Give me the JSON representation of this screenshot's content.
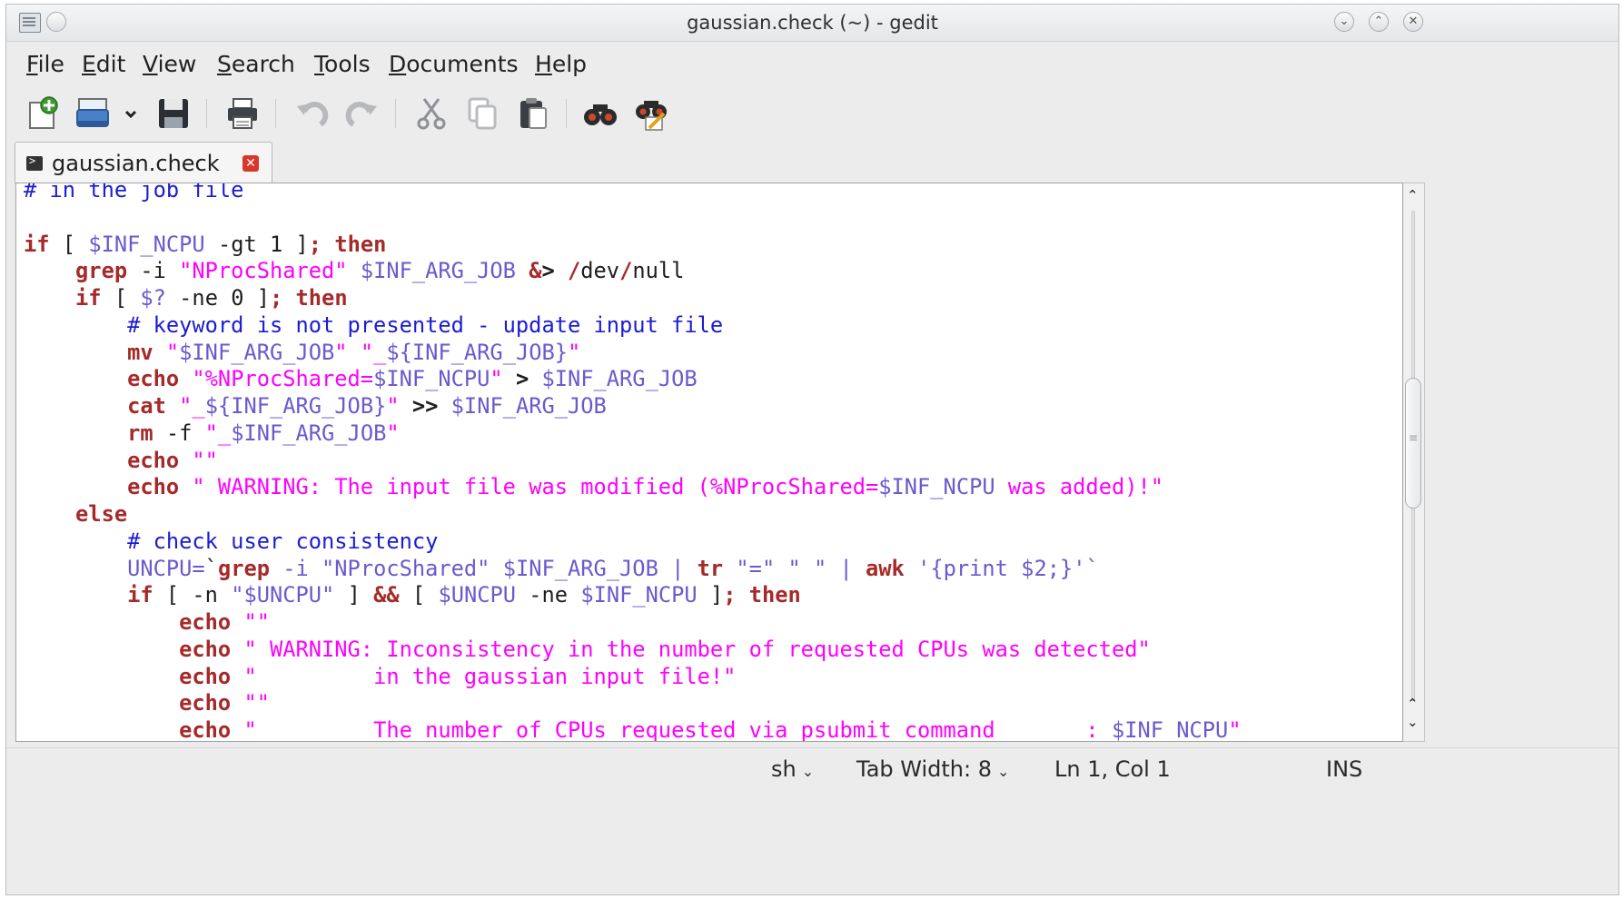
{
  "window": {
    "title": "gaussian.check (~) - gedit"
  },
  "menu": [
    {
      "label": "File",
      "mnemonic": "F",
      "rest": "ile"
    },
    {
      "label": "Edit",
      "mnemonic": "E",
      "rest": "dit"
    },
    {
      "label": "View",
      "mnemonic": "V",
      "rest": "iew"
    },
    {
      "label": "Search",
      "mnemonic": "S",
      "rest": "earch"
    },
    {
      "label": "Tools",
      "mnemonic": "T",
      "rest": "ools"
    },
    {
      "label": "Documents",
      "mnemonic": "D",
      "rest": "ocuments"
    },
    {
      "label": "Help",
      "mnemonic": "H",
      "rest": "elp"
    }
  ],
  "toolbar": {
    "icons": [
      "new-document-icon",
      "open-icon",
      "open-dropdown-icon",
      "save-icon",
      "print-icon",
      "undo-icon",
      "redo-icon",
      "cut-icon",
      "copy-icon",
      "paste-icon",
      "find-icon",
      "find-replace-icon"
    ]
  },
  "tab": {
    "label": "gaussian.check"
  },
  "code": {
    "lines": [
      [
        {
          "t": "# in the job file",
          "c": "cm"
        }
      ],
      [],
      [
        {
          "t": "if",
          "c": "kw"
        },
        {
          "t": " [ ",
          "c": "pl"
        },
        {
          "t": "$INF_NCPU",
          "c": "va"
        },
        {
          "t": " -gt 1 ]",
          "c": "pl"
        },
        {
          "t": ";",
          "c": "kw"
        },
        {
          "t": " ",
          "c": "pl"
        },
        {
          "t": "then",
          "c": "kw"
        }
      ],
      [
        {
          "t": "    ",
          "c": "pl"
        },
        {
          "t": "grep",
          "c": "kw"
        },
        {
          "t": " -i ",
          "c": "pl"
        },
        {
          "t": "\"NProcShared\"",
          "c": "st"
        },
        {
          "t": " ",
          "c": "pl"
        },
        {
          "t": "$INF_ARG_JOB",
          "c": "va"
        },
        {
          "t": " ",
          "c": "pl"
        },
        {
          "t": "&",
          "c": "kw"
        },
        {
          "t": "> ",
          "c": "op"
        },
        {
          "t": "/",
          "c": "kw"
        },
        {
          "t": "dev",
          "c": "pl"
        },
        {
          "t": "/",
          "c": "kw"
        },
        {
          "t": "null",
          "c": "pl"
        }
      ],
      [
        {
          "t": "    ",
          "c": "pl"
        },
        {
          "t": "if",
          "c": "kw"
        },
        {
          "t": " [ ",
          "c": "pl"
        },
        {
          "t": "$?",
          "c": "va"
        },
        {
          "t": " -ne 0 ]",
          "c": "pl"
        },
        {
          "t": ";",
          "c": "kw"
        },
        {
          "t": " ",
          "c": "pl"
        },
        {
          "t": "then",
          "c": "kw"
        }
      ],
      [
        {
          "t": "        ",
          "c": "pl"
        },
        {
          "t": "# keyword is not presented - update input file",
          "c": "cm"
        }
      ],
      [
        {
          "t": "        ",
          "c": "pl"
        },
        {
          "t": "mv",
          "c": "kw"
        },
        {
          "t": " ",
          "c": "pl"
        },
        {
          "t": "\"",
          "c": "st"
        },
        {
          "t": "$INF_ARG_JOB",
          "c": "va"
        },
        {
          "t": "\" \"_",
          "c": "st"
        },
        {
          "t": "${INF_ARG_JOB}",
          "c": "va"
        },
        {
          "t": "\"",
          "c": "st"
        }
      ],
      [
        {
          "t": "        ",
          "c": "pl"
        },
        {
          "t": "echo",
          "c": "kw"
        },
        {
          "t": " ",
          "c": "pl"
        },
        {
          "t": "\"%NProcShared=",
          "c": "st"
        },
        {
          "t": "$INF_NCPU",
          "c": "va"
        },
        {
          "t": "\"",
          "c": "st"
        },
        {
          "t": " ",
          "c": "pl"
        },
        {
          "t": ">",
          "c": "op"
        },
        {
          "t": " ",
          "c": "pl"
        },
        {
          "t": "$INF_ARG_JOB",
          "c": "va"
        }
      ],
      [
        {
          "t": "        ",
          "c": "pl"
        },
        {
          "t": "cat",
          "c": "kw"
        },
        {
          "t": " ",
          "c": "pl"
        },
        {
          "t": "\"_",
          "c": "st"
        },
        {
          "t": "${INF_ARG_JOB}",
          "c": "va"
        },
        {
          "t": "\"",
          "c": "st"
        },
        {
          "t": " ",
          "c": "pl"
        },
        {
          "t": ">>",
          "c": "op"
        },
        {
          "t": " ",
          "c": "pl"
        },
        {
          "t": "$INF_ARG_JOB",
          "c": "va"
        }
      ],
      [
        {
          "t": "        ",
          "c": "pl"
        },
        {
          "t": "rm",
          "c": "kw"
        },
        {
          "t": " -f ",
          "c": "pl"
        },
        {
          "t": "\"_",
          "c": "st"
        },
        {
          "t": "$INF_ARG_JOB",
          "c": "va"
        },
        {
          "t": "\"",
          "c": "st"
        }
      ],
      [
        {
          "t": "        ",
          "c": "pl"
        },
        {
          "t": "echo",
          "c": "kw"
        },
        {
          "t": " ",
          "c": "pl"
        },
        {
          "t": "\"\"",
          "c": "st"
        }
      ],
      [
        {
          "t": "        ",
          "c": "pl"
        },
        {
          "t": "echo",
          "c": "kw"
        },
        {
          "t": " ",
          "c": "pl"
        },
        {
          "t": "\" WARNING: The input file was modified (%NProcShared=",
          "c": "st"
        },
        {
          "t": "$INF_NCPU",
          "c": "va"
        },
        {
          "t": " was added)!\"",
          "c": "st"
        }
      ],
      [
        {
          "t": "    ",
          "c": "pl"
        },
        {
          "t": "else",
          "c": "kw"
        }
      ],
      [
        {
          "t": "        ",
          "c": "pl"
        },
        {
          "t": "# check user consistency",
          "c": "cm"
        }
      ],
      [
        {
          "t": "        ",
          "c": "pl"
        },
        {
          "t": "UNCPU=",
          "c": "va"
        },
        {
          "t": "`",
          "c": "pl"
        },
        {
          "t": "grep",
          "c": "kw"
        },
        {
          "t": " -i ",
          "c": "va"
        },
        {
          "t": "\"NProcShared\"",
          "c": "va"
        },
        {
          "t": " $INF_ARG_JOB | ",
          "c": "va"
        },
        {
          "t": "tr",
          "c": "kw"
        },
        {
          "t": " \"=\" \" \" | ",
          "c": "va"
        },
        {
          "t": "awk",
          "c": "kw"
        },
        {
          "t": " '{print $2;}'`",
          "c": "va"
        }
      ],
      [
        {
          "t": "        ",
          "c": "pl"
        },
        {
          "t": "if",
          "c": "kw"
        },
        {
          "t": " [ -n ",
          "c": "pl"
        },
        {
          "t": "\"",
          "c": "va"
        },
        {
          "t": "$UNCPU",
          "c": "va"
        },
        {
          "t": "\"",
          "c": "va"
        },
        {
          "t": " ] ",
          "c": "pl"
        },
        {
          "t": "&&",
          "c": "kw"
        },
        {
          "t": " [ ",
          "c": "pl"
        },
        {
          "t": "$UNCPU",
          "c": "va"
        },
        {
          "t": " -ne ",
          "c": "pl"
        },
        {
          "t": "$INF_NCPU",
          "c": "va"
        },
        {
          "t": " ]",
          "c": "pl"
        },
        {
          "t": ";",
          "c": "kw"
        },
        {
          "t": " ",
          "c": "pl"
        },
        {
          "t": "then",
          "c": "kw"
        }
      ],
      [
        {
          "t": "            ",
          "c": "pl"
        },
        {
          "t": "echo",
          "c": "kw"
        },
        {
          "t": " ",
          "c": "pl"
        },
        {
          "t": "\"\"",
          "c": "st"
        }
      ],
      [
        {
          "t": "            ",
          "c": "pl"
        },
        {
          "t": "echo",
          "c": "kw"
        },
        {
          "t": " ",
          "c": "pl"
        },
        {
          "t": "\" WARNING: Inconsistency in the number of requested CPUs was detected\"",
          "c": "st"
        }
      ],
      [
        {
          "t": "            ",
          "c": "pl"
        },
        {
          "t": "echo",
          "c": "kw"
        },
        {
          "t": " ",
          "c": "pl"
        },
        {
          "t": "\"         in the gaussian input file!\"",
          "c": "st"
        }
      ],
      [
        {
          "t": "            ",
          "c": "pl"
        },
        {
          "t": "echo",
          "c": "kw"
        },
        {
          "t": " ",
          "c": "pl"
        },
        {
          "t": "\"\"",
          "c": "st"
        }
      ],
      [
        {
          "t": "            ",
          "c": "pl"
        },
        {
          "t": "echo",
          "c": "kw"
        },
        {
          "t": " ",
          "c": "pl"
        },
        {
          "t": "\"         The number of CPUs requested via psubmit command       : ",
          "c": "st"
        },
        {
          "t": "$INF_NCPU",
          "c": "va"
        },
        {
          "t": "\"",
          "c": "st"
        }
      ]
    ]
  },
  "statusbar": {
    "language": "sh",
    "tab_width": "Tab Width:  8",
    "position": "Ln 1, Col 1",
    "mode": "INS"
  }
}
